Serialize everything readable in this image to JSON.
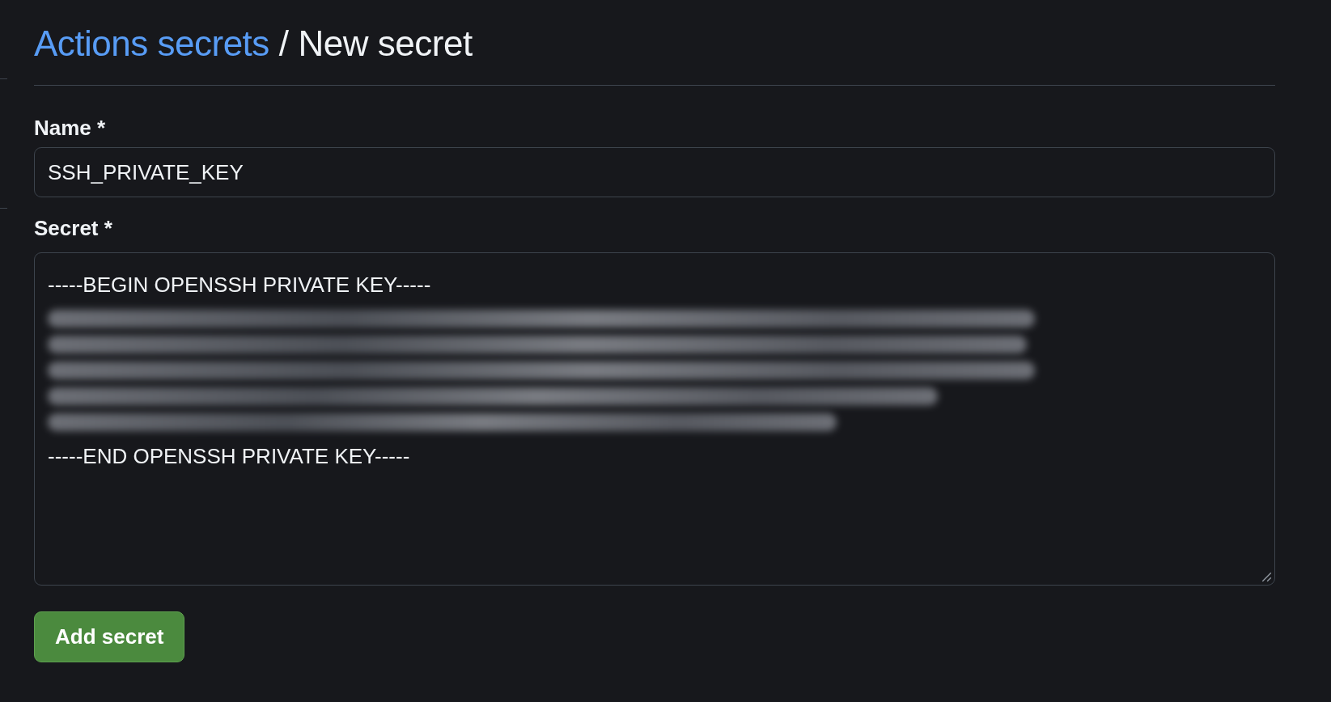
{
  "breadcrumb": {
    "link": "Actions secrets",
    "separator": "/",
    "current": "New secret"
  },
  "name_field": {
    "label": "Name *",
    "value": "SSH_PRIVATE_KEY"
  },
  "secret_field": {
    "label": "Secret *",
    "lines": [
      {
        "kind": "text",
        "text": "-----BEGIN OPENSSH PRIVATE KEY-----"
      },
      {
        "kind": "blurred"
      },
      {
        "kind": "blurred"
      },
      {
        "kind": "blurred"
      },
      {
        "kind": "blurred"
      },
      {
        "kind": "blurred"
      },
      {
        "kind": "text",
        "text": "-----END OPENSSH PRIVATE KEY-----"
      }
    ]
  },
  "buttons": [
    {
      "label": "Add secret",
      "kind": "primary"
    }
  ]
}
